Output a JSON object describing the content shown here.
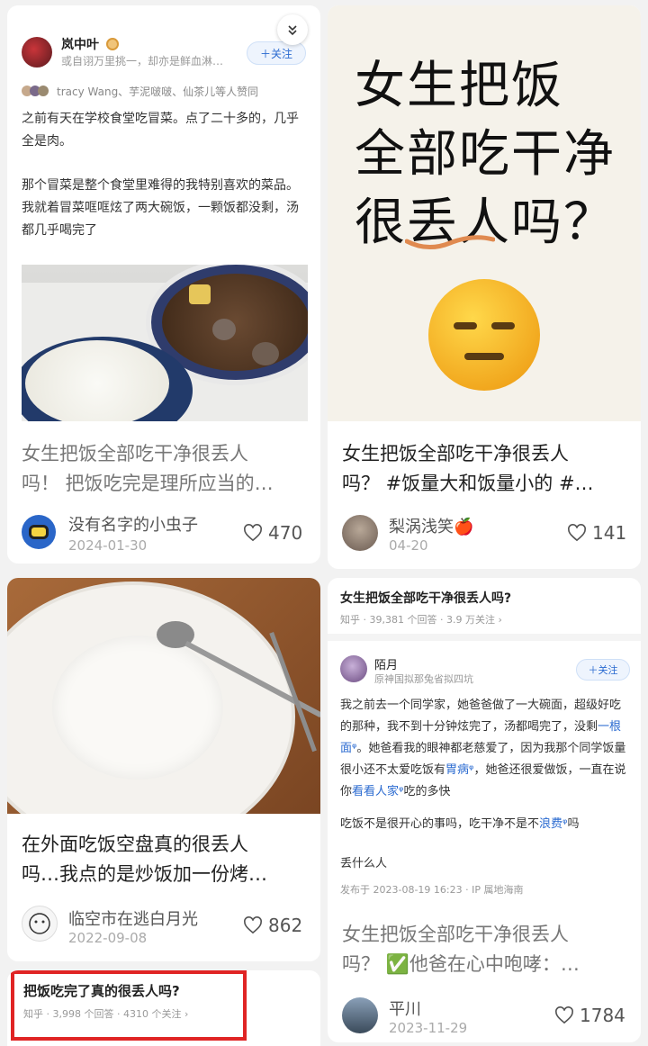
{
  "card1": {
    "author": "岚中叶",
    "tagline": "或自诩万里挑一，却亦是鲜血淋…",
    "follow": "＋关注",
    "liked_by": "tracy Wang、芋泥啵啵、仙茶儿等人赞同",
    "para1": "之前有天在学校食堂吃冒菜。点了二十多的，几乎全是肉。",
    "para2": "那个冒菜是整个食堂里难得的我特别喜欢的菜品。我就着冒菜哐哐炫了两大碗饭，一颗饭都没剩，汤都几乎喝完了",
    "title_line1": "女生把饭全部吃干净很丢人",
    "title_line2": "吗！ 把饭吃完是理所应当的…",
    "footer_author": "没有名字的小虫子",
    "footer_date": "2024-01-30",
    "likes": "470"
  },
  "card2": {
    "cover_line1": "女生把饭",
    "cover_line2": "全部吃干净",
    "cover_line3": "很丢人吗？",
    "title_line1": "女生把饭全部吃干净很丢人",
    "title_line2": "吗？ #饭量大和饭量小的 #…",
    "footer_author": "梨涡浅笑🍎",
    "footer_date": "04-20",
    "likes": "141"
  },
  "card3": {
    "title_line1": "在外面吃饭空盘真的很丢人",
    "title_line2": "吗…我点的是炒饭加一份烤…",
    "footer_author": "临空市在逃白月光",
    "footer_date": "2022-09-08",
    "likes": "862"
  },
  "card4": {
    "question": "女生把饭全部吃干净很丢人吗?",
    "meta": "知乎 · 39,381 个回答 · 3.9 万关注 ›",
    "answer_author": "陌月",
    "answer_sub": "原神国拟那兔省拟四坑",
    "follow": "＋关注",
    "para_a": "我之前去一个同学家，她爸爸做了一大碗面，超级好吃的那种，我不到十分钟炫完了，汤都喝完了，没剩",
    "link1": "一根面",
    "para_b": "。她爸看我的眼神都老慈爱了，因为我那个同学饭量很小还不太爱吃饭有",
    "link2": "胃病",
    "para_c": "，她爸还很爱做饭，一直在说你",
    "link3": "看看人家",
    "para_d": "吃的多快",
    "para2a": "吃饭不是很开心的事吗，吃干净不是不",
    "link4": "浪费",
    "para2b": "吗",
    "para3": "丢什么人",
    "published": "发布于 2023-08-19 16:23 · IP 属地海南",
    "title_line1": "女生把饭全部吃干净很丢人",
    "title_line2": "吗？ ✅他爸在心中咆哮：…",
    "footer_author": "平川",
    "footer_date": "2023-11-29",
    "likes": "1784"
  },
  "card5": {
    "question": "把饭吃完了真的很丢人吗?",
    "meta": "知乎 · 3,998 个回答 · 4310 个关注 ›"
  },
  "colors": {
    "accent_blue": "#2a6ad0",
    "highlight_red": "#e02424",
    "cover_bg": "#f5f2ea"
  }
}
